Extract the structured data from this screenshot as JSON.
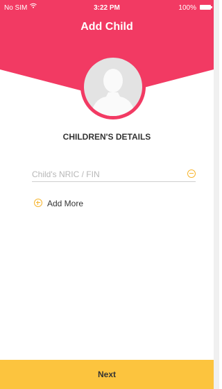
{
  "status_bar": {
    "carrier": "No SIM",
    "time": "3:22 PM",
    "battery": "100%"
  },
  "header": {
    "title": "Add Child",
    "color": "#f23a63"
  },
  "section": {
    "title": "CHILDREN'S DETAILS"
  },
  "form": {
    "nric_placeholder": "Child's NRIC / FIN",
    "add_more_label": "Add More"
  },
  "footer": {
    "next_label": "Next",
    "color": "#fcc43e"
  },
  "icons": [
    "wifi-icon",
    "battery-icon",
    "avatar-placeholder-icon",
    "remove-field-icon",
    "add-circle-icon"
  ]
}
